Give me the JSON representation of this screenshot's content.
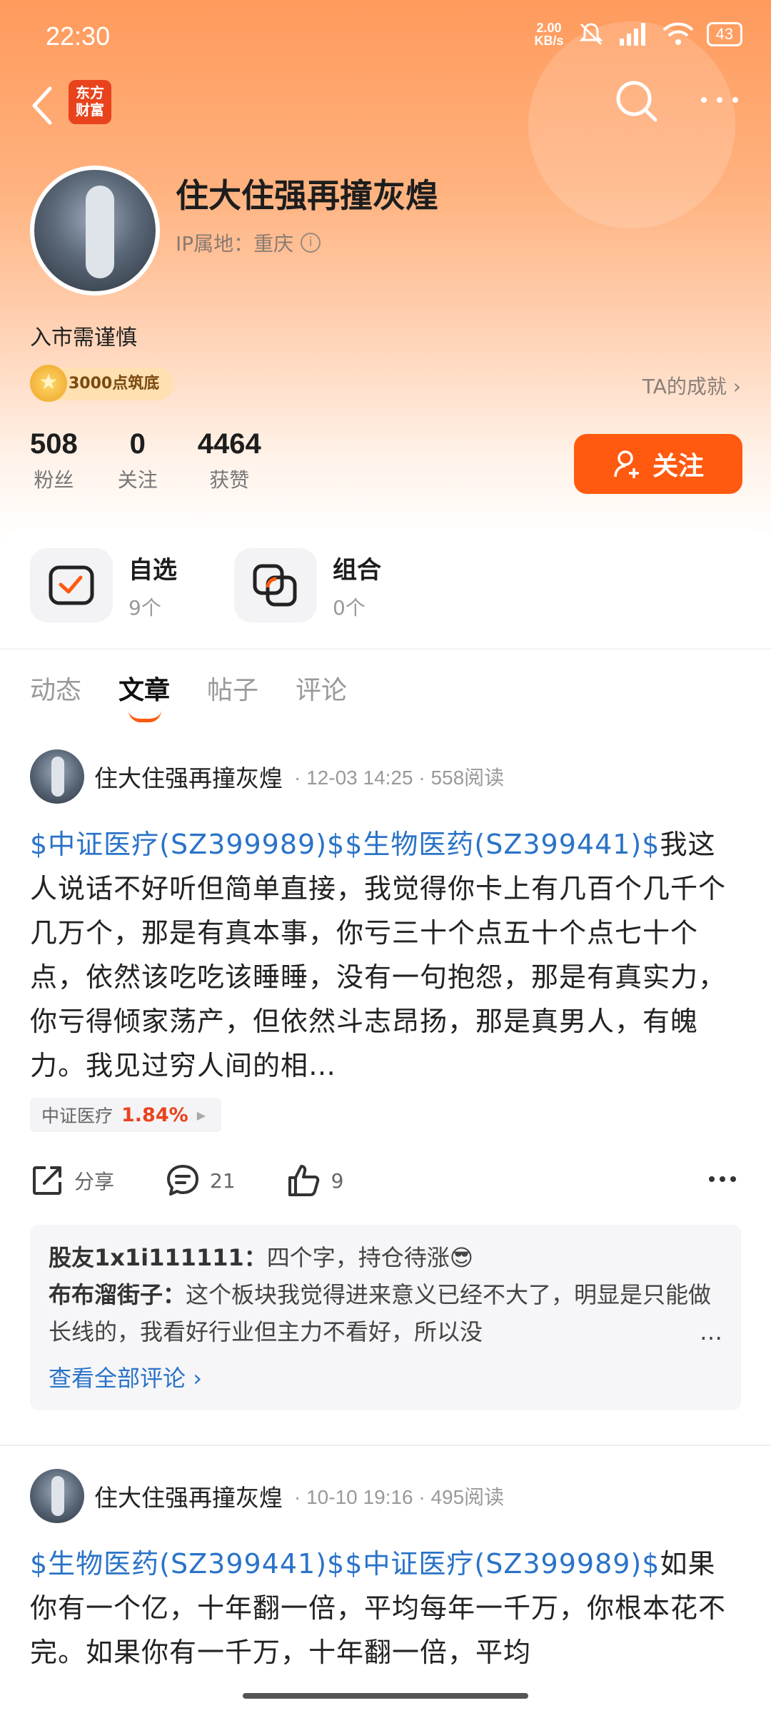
{
  "status_bar": {
    "time": "22:30",
    "net_speed_value": "2.00",
    "net_speed_unit": "KB/s",
    "battery": "43"
  },
  "topbar": {
    "logo_line1": "东方",
    "logo_line2": "财富"
  },
  "profile": {
    "name": "住大住强再撞灰煌",
    "ip_location": "IP属地：重庆",
    "bio": "入市需谨慎",
    "badge": "3000点筑底",
    "achievements_link": "TA的成就",
    "stats": [
      {
        "value": "508",
        "label": "粉丝"
      },
      {
        "value": "0",
        "label": "关注"
      },
      {
        "value": "4464",
        "label": "获赞"
      }
    ],
    "follow_label": "关注"
  },
  "quick": [
    {
      "title": "自选",
      "sub": "9个"
    },
    {
      "title": "组合",
      "sub": "0个"
    }
  ],
  "tabs": [
    "动态",
    "文章",
    "帖子",
    "评论"
  ],
  "active_tab": "文章",
  "posts": [
    {
      "author": "住大住强再撞灰煌",
      "meta": "· 12-03 14:25 · 558阅读",
      "tag1": "$中证医疗(SZ399989)$",
      "tag2": "$生物医药(SZ399441)$",
      "text": "我这人说话不好听但简单直接，我觉得你卡上有几百个几千个几万个，那是有真本事，你亏三十个点五十个点七十个点，依然该吃吃该睡睡，没有一句抱怨，那是有真实力，你亏得倾家荡产，但依然斗志昂扬，那是真男人，有魄力。我见过穷人间的相…",
      "stock_name": "中证医疗",
      "stock_pct": "1.84%",
      "share_label": "分享",
      "comment_count": "21",
      "like_count": "9",
      "comments": [
        {
          "user": "股友1x1i111111：",
          "text": "四个字，持仓待涨😎"
        },
        {
          "user": "布布溜街子：",
          "text": "这个板块我觉得进来意义已经不大了，明显是只能做长线的，我看好行业但主力不看好，所以没"
        }
      ],
      "view_all": "查看全部评论"
    },
    {
      "author": "住大住强再撞灰煌",
      "meta": "· 10-10 19:16 · 495阅读",
      "tag1": "$生物医药(SZ399441)$",
      "tag2": "$中证医疗(SZ399989)$",
      "text": "如果你有一个亿，十年翻一倍，平均每年一千万，你根本花不完。如果你有一千万，十年翻一倍，平均"
    }
  ]
}
